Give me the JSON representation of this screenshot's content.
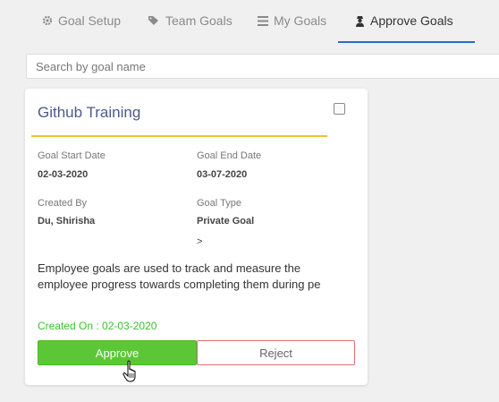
{
  "tabs": [
    {
      "label": "Goal Setup",
      "icon": "gear-icon",
      "active": false
    },
    {
      "label": "Team Goals",
      "icon": "tags-icon",
      "active": false
    },
    {
      "label": "My Goals",
      "icon": "list-icon",
      "active": false
    },
    {
      "label": "Approve Goals",
      "icon": "user-secret-icon",
      "active": true
    }
  ],
  "search": {
    "placeholder": "Search by goal name",
    "value": ""
  },
  "card": {
    "title": "Github Training",
    "selected": false,
    "fields": {
      "start_label": "Goal Start Date",
      "start_value": "02-03-2020",
      "end_label": "Goal End Date",
      "end_value": "03-07-2020",
      "created_by_label": "Created By",
      "created_by_value": "Du, Shirisha",
      "type_label": "Goal Type",
      "type_value": "Private Goal",
      "more": ">"
    },
    "description": "Employee goals are used to track and measure the employee progress towards completing them during pe",
    "created_on": "Created On : 02-03-2020",
    "approve_label": "Approve",
    "reject_label": "Reject"
  },
  "colors": {
    "accent": "#2b6cc4",
    "approve": "#5cc736",
    "reject_border": "#e07070",
    "title_rule": "#f2c230",
    "created_on": "#3ac22e"
  }
}
